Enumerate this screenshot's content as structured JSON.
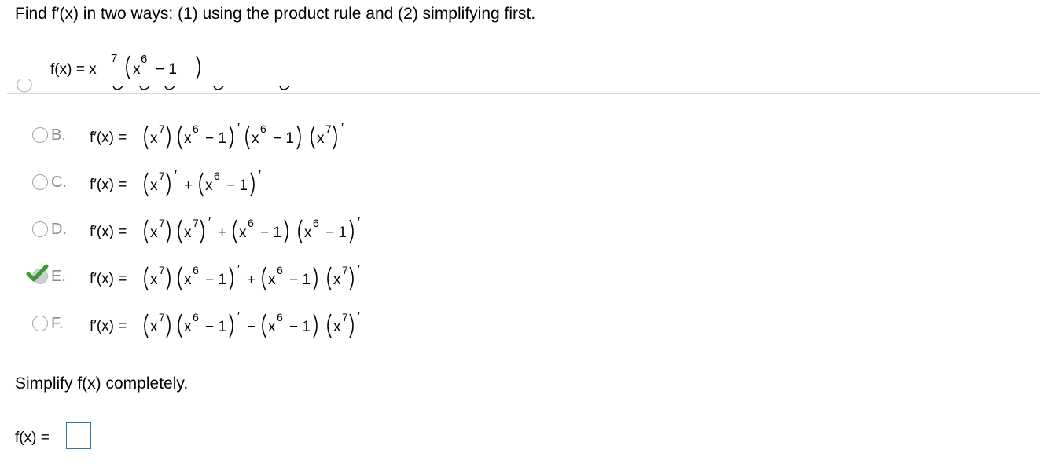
{
  "prompt": "Find f′(x) in two ways: (1) using the product rule and (2) simplifying first.",
  "given": {
    "lhs": "f(x) = x",
    "exp1": "7",
    "base2": "x",
    "exp2": "6",
    "tail": "− 1"
  },
  "options": [
    {
      "letter": "B.",
      "selected": false,
      "expression": "f′(x) = (x⁷) (x⁶ − 1)′(x⁶ − 1) (x⁷)′"
    },
    {
      "letter": "C.",
      "selected": false,
      "expression": "f′(x) = (x⁷)′ + (x⁶ − 1)′"
    },
    {
      "letter": "D.",
      "selected": false,
      "expression": "f′(x) = (x⁷) (x⁷)′ + (x⁶ − 1) (x⁶ − 1)′"
    },
    {
      "letter": "E.",
      "selected": true,
      "expression": "f′(x) = (x⁷) (x⁶ − 1)′ + (x⁶ − 1) (x⁷)′"
    },
    {
      "letter": "F.",
      "selected": false,
      "expression": "f′(x) = (x⁷) (x⁶ − 1)′ − (x⁶ − 1) (x⁷)′"
    }
  ],
  "instruction": "Simplify f(x) completely.",
  "answer": {
    "label": "f(x) =",
    "value": ""
  }
}
